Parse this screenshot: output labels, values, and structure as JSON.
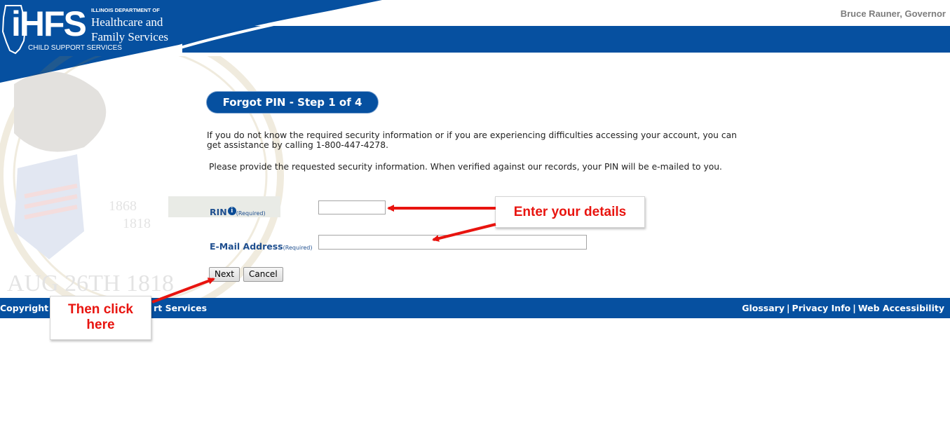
{
  "header": {
    "logo_text": "iHFS",
    "dept_small": "ILLINOIS DEPARTMENT OF",
    "dept_line1": "Healthcare and",
    "dept_line2": "Family Services",
    "dept_sub": "CHILD SUPPORT SERVICES",
    "governor": "Bruce Rauner, Governor"
  },
  "seal": {
    "text_1868": "1868",
    "text_1818": "1818",
    "text_aug": "AUG 26TH 1818"
  },
  "form": {
    "title": "Forgot PIN - Step 1 of 4",
    "paragraph1": "If you do not know the required security information or if you are experiencing difficulties accessing your account, you can get assistance by calling 1-800-447-4278.",
    "paragraph2": "Please provide the requested security information. When verified against our records, your PIN will be e-mailed to you.",
    "rin_label": "RIN",
    "rin_required": "(Required)",
    "rin_value": "",
    "email_label": "E-Mail Address",
    "email_required": "(Required)",
    "email_value": "",
    "next_label": "Next",
    "cancel_label": "Cancel"
  },
  "footer": {
    "copyright": "Copyright",
    "services_fragment": "rt Services",
    "links": [
      "Glossary",
      "Privacy Info",
      "Web Accessibility"
    ],
    "separator": "|"
  },
  "annotations": {
    "callout1": "Enter your details",
    "callout2_line1": "Then click",
    "callout2_line2": "here"
  },
  "colors": {
    "brand_blue": "#0650a0",
    "callout_red": "#e8140f",
    "governor_gray": "#7d7d7d"
  },
  "icons": [
    "info-icon",
    "illinois-outline-icon",
    "red-arrow-icon"
  ]
}
